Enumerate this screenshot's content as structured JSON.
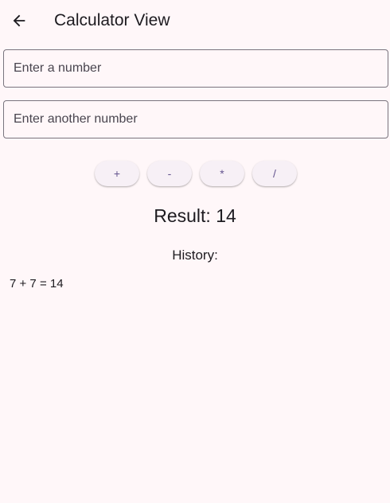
{
  "app_bar": {
    "back_icon": "arrow-left-icon",
    "title": "Calculator View"
  },
  "inputs": {
    "first": {
      "placeholder": "Enter a number",
      "value": ""
    },
    "second": {
      "placeholder": "Enter another number",
      "value": ""
    }
  },
  "operations": [
    {
      "label": "+"
    },
    {
      "label": "-"
    },
    {
      "label": "*"
    },
    {
      "label": "/"
    }
  ],
  "result": {
    "text": "Result: 14"
  },
  "history": {
    "label": "History:",
    "items": [
      "7 + 7 = 14"
    ]
  },
  "colors": {
    "background": "#fff7f9",
    "button_text": "#65558f",
    "border": "#79747e"
  }
}
